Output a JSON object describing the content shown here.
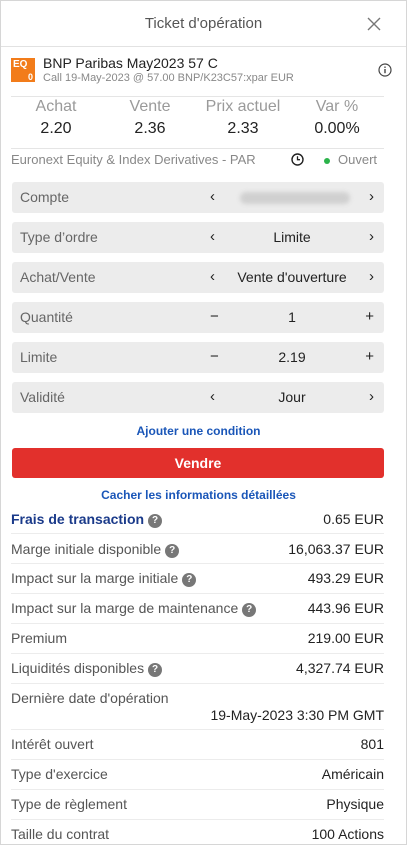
{
  "title": "Ticket d'opération",
  "instrument": {
    "logo_top": "EQ",
    "logo_bottom": "0",
    "name": "BNP Paribas May2023 57 C",
    "subtitle": "Call 19-May-2023 @ 57.00 BNP/K23C57:xpar EUR"
  },
  "quotes": [
    {
      "label": "Achat",
      "value": "2.20"
    },
    {
      "label": "Vente",
      "value": "2.36"
    },
    {
      "label": "Prix actuel",
      "value": "2.33"
    },
    {
      "label": "Var %",
      "value": "0.00%"
    }
  ],
  "market": {
    "name": "Euronext Equity & Index Derivatives - PAR",
    "status": "Ouvert",
    "status_color": "#2bb34a"
  },
  "fields": {
    "compte": {
      "label": "Compte",
      "value": ""
    },
    "type_ordre": {
      "label": "Type d’ordre",
      "value": "Limite"
    },
    "achat_vente": {
      "label": "Achat/Vente",
      "value": "Vente d'ouverture"
    },
    "quantite": {
      "label": "Quantité",
      "value": "1"
    },
    "limite": {
      "label": "Limite",
      "value": "2.19"
    },
    "validite": {
      "label": "Validité",
      "value": "Jour"
    }
  },
  "add_condition": "Ajouter une condition",
  "submit": {
    "label": "Vendre",
    "color": "#e2302c"
  },
  "hide_details": "Cacher les informations détaillées",
  "details": {
    "frais": {
      "label": "Frais de transaction",
      "value": "0.65 EUR"
    },
    "marge_initiale_dispo": {
      "label": "Marge initiale disponible",
      "value": "16,063.37 EUR"
    },
    "impact_marge_initiale": {
      "label": "Impact sur la marge initiale",
      "value": "493.29 EUR"
    },
    "impact_marge_maintenance": {
      "label": "Impact sur la marge de maintenance",
      "value": "443.96 EUR"
    },
    "premium": {
      "label": "Premium",
      "value": "219.00 EUR"
    },
    "liquidites": {
      "label": "Liquidités disponibles",
      "value": "4,327.74 EUR"
    },
    "derniere_date": {
      "label": "Dernière date d'opération",
      "value": "19-May-2023 3:30 PM GMT"
    },
    "interet_ouvert": {
      "label": "Intérêt ouvert",
      "value": "801"
    },
    "type_exercice": {
      "label": "Type d'exercice",
      "value": "Américain"
    },
    "type_reglement": {
      "label": "Type de règlement",
      "value": "Physique"
    },
    "taille_contrat": {
      "label": "Taille du contrat",
      "value": "100 Actions"
    }
  },
  "icons": {
    "help": "?",
    "prev": "‹",
    "next": "›",
    "minus": "−",
    "plus": "+"
  }
}
